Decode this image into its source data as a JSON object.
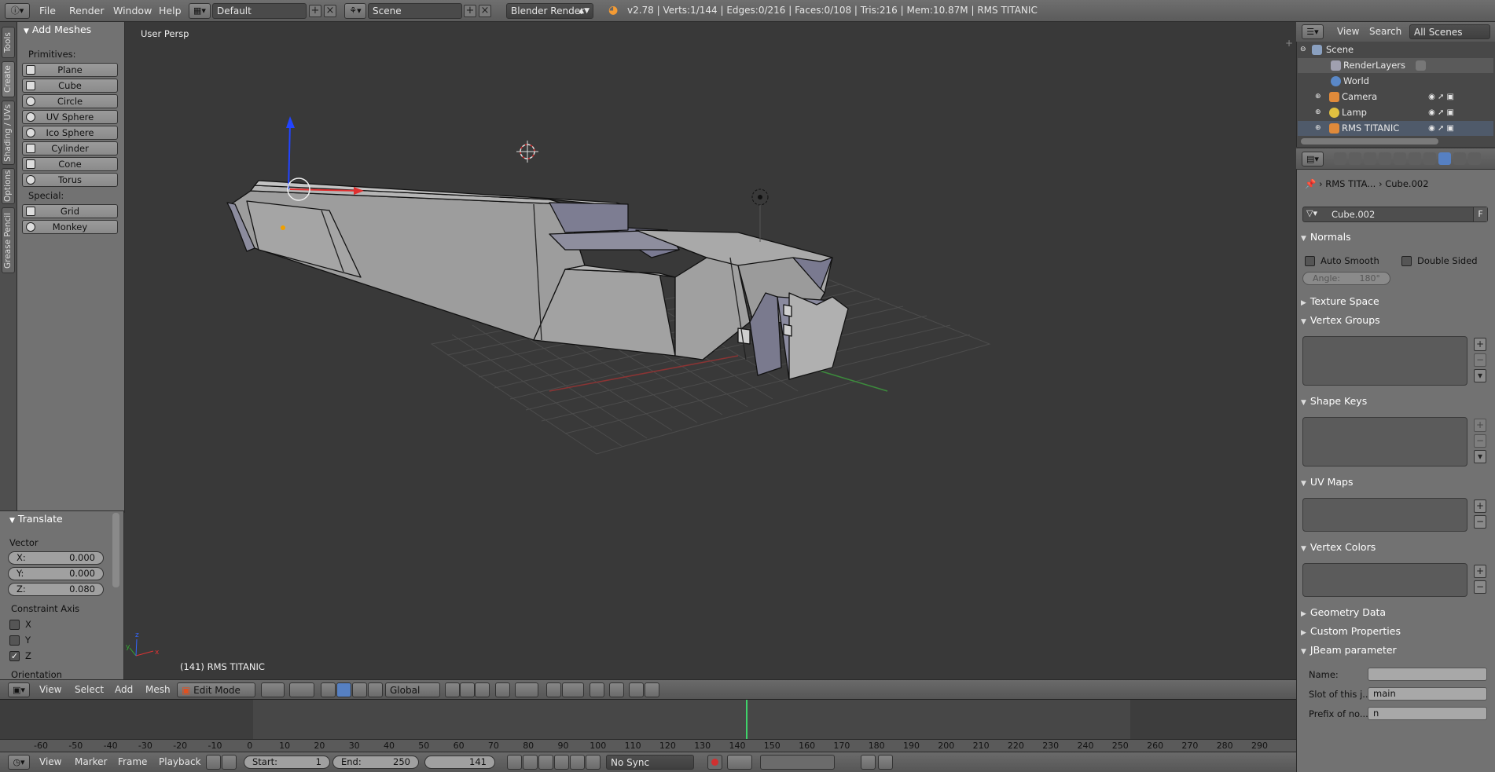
{
  "topbar": {
    "menus": [
      "File",
      "Render",
      "Window",
      "Help"
    ],
    "screen_layout": "Default",
    "scene": "Scene",
    "engine": "Blender Render",
    "stats": "v2.78 | Verts:1/144 | Edges:0/216 | Faces:0/108 | Tris:216 | Mem:10.87M | RMS TITANIC"
  },
  "left_tabs": [
    "Tools",
    "Create",
    "Shading / UVs",
    "Options",
    "Grease Pencil"
  ],
  "toolshelf": {
    "panel_title": "Add Meshes",
    "primitives_label": "Primitives:",
    "primitives": [
      "Plane",
      "Cube",
      "Circle",
      "UV Sphere",
      "Ico Sphere",
      "Cylinder",
      "Cone",
      "Torus"
    ],
    "special_label": "Special:",
    "special": [
      "Grid",
      "Monkey"
    ]
  },
  "redo_panel": {
    "title": "Translate",
    "vector_label": "Vector",
    "x_label": "X:",
    "x_value": "0.000",
    "y_label": "Y:",
    "y_value": "0.000",
    "z_label": "Z:",
    "z_value": "0.080",
    "constraint_label": "Constraint Axis",
    "axis_x": "X",
    "axis_y": "Y",
    "axis_z": "Z",
    "axis_x_checked": false,
    "axis_y_checked": false,
    "axis_z_checked": true,
    "orientation_label": "Orientation"
  },
  "viewport": {
    "view_name": "User Persp",
    "object_info": "(141) RMS TITANIC",
    "axis_x": "x",
    "axis_y": "y",
    "axis_z": "z"
  },
  "view3d_header": {
    "menus": [
      "View",
      "Select",
      "Add",
      "Mesh"
    ],
    "mode": "Edit Mode",
    "orientation": "Global"
  },
  "timeline": {
    "ticks": [
      "-60",
      "-50",
      "-40",
      "-30",
      "-20",
      "-10",
      "0",
      "10",
      "20",
      "30",
      "40",
      "50",
      "60",
      "70",
      "80",
      "90",
      "100",
      "110",
      "120",
      "130",
      "140",
      "150",
      "160",
      "170",
      "180",
      "190",
      "200",
      "210",
      "220",
      "230",
      "240",
      "250",
      "260",
      "270",
      "280",
      "290"
    ],
    "current_frame": 141
  },
  "timeline_header": {
    "menus": [
      "View",
      "Marker",
      "Frame",
      "Playback"
    ],
    "start_label": "Start:",
    "start": "1",
    "end_label": "End:",
    "end": "250",
    "current": "141",
    "sync": "No Sync"
  },
  "outliner": {
    "menus": [
      "View",
      "Search"
    ],
    "filter": "All Scenes",
    "rows": [
      "Scene",
      "RenderLayers",
      "World",
      "Camera",
      "Lamp",
      "RMS TITANIC"
    ]
  },
  "properties": {
    "breadcrumb_object": "RMS TITA...",
    "breadcrumb_mesh": "Cube.002",
    "mesh_name": "Cube.002",
    "fake_user": "F",
    "sections": {
      "normals": "Normals",
      "auto_smooth": "Auto Smooth",
      "double_sided": "Double Sided",
      "angle": "Angle:",
      "angle_value": "180°",
      "texture_space": "Texture Space",
      "vertex_groups": "Vertex Groups",
      "shape_keys": "Shape Keys",
      "uv_maps": "UV Maps",
      "vertex_colors": "Vertex Colors",
      "geometry_data": "Geometry Data",
      "custom_properties": "Custom Properties",
      "jbeam": "JBeam parameter"
    },
    "jbeam": {
      "name_label": "Name:",
      "name_value": "",
      "slot_label": "Slot of this j...",
      "slot_value": "main",
      "prefix_label": "Prefix of no...",
      "prefix_value": "n"
    }
  }
}
